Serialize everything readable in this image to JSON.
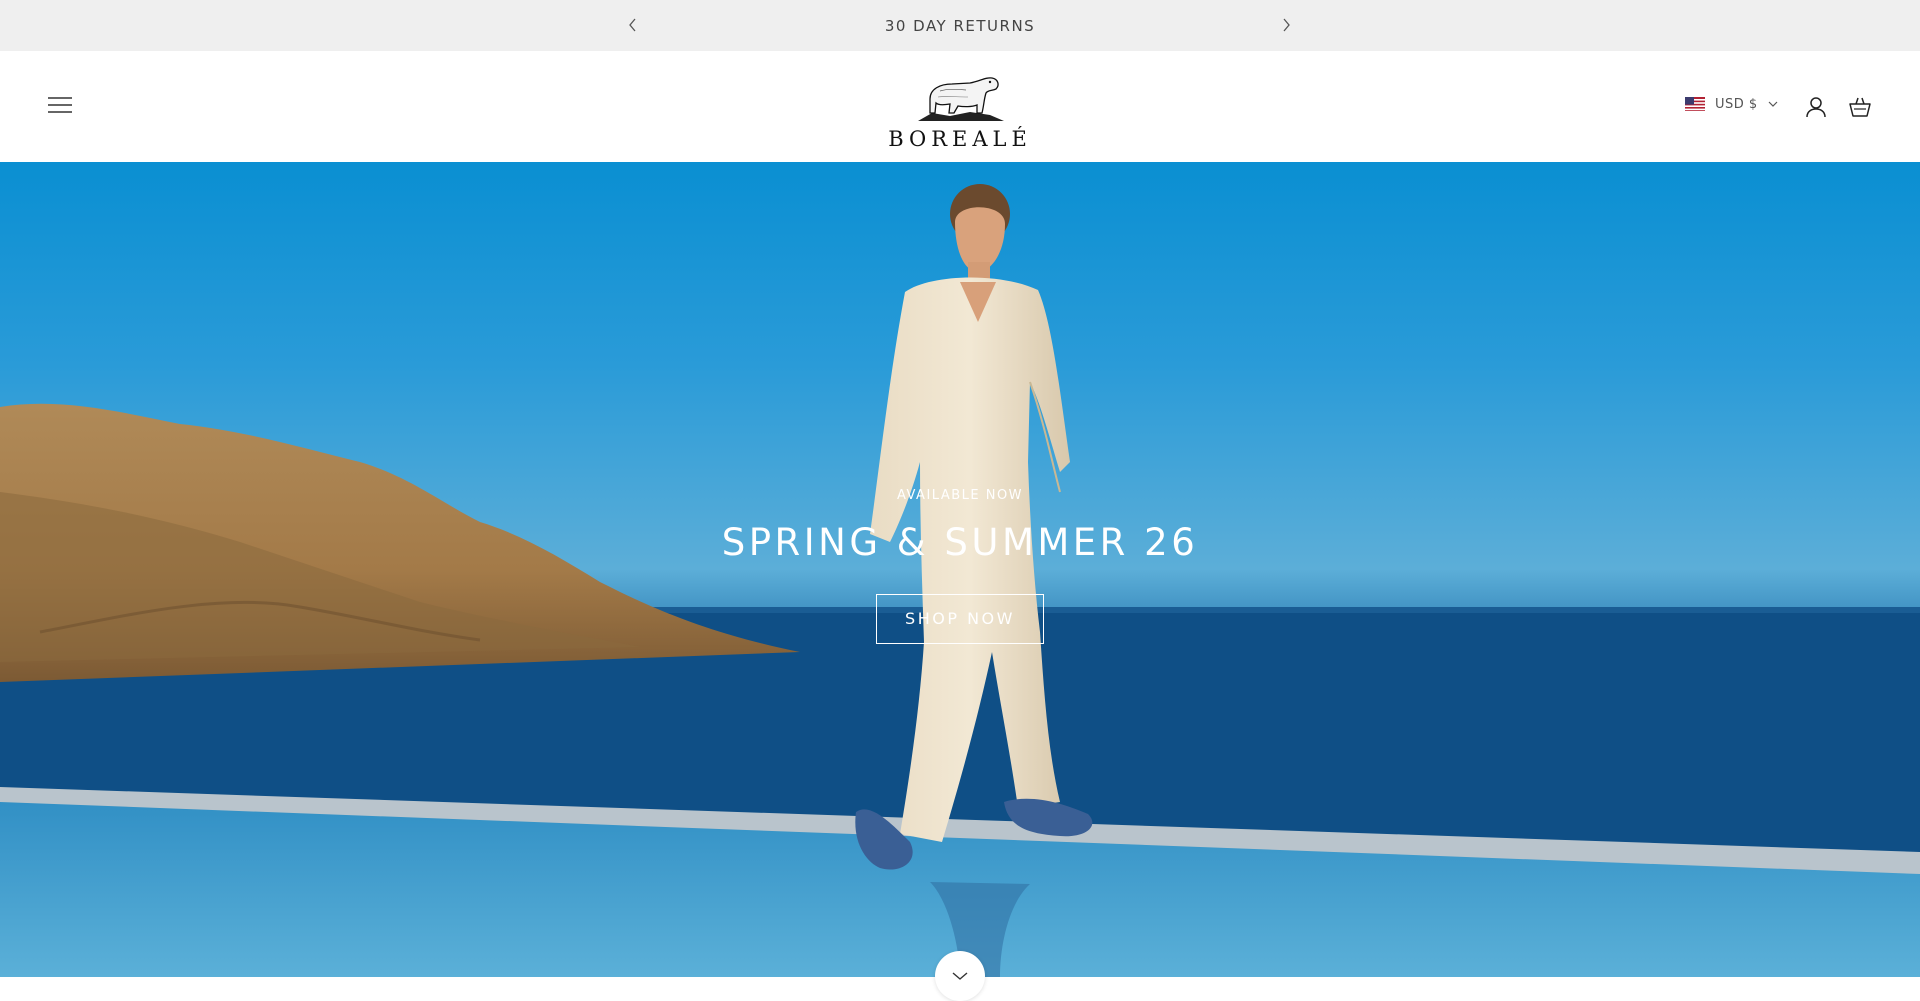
{
  "announcement": {
    "text": "30 DAY RETURNS",
    "prev_icon": "chevron-left-icon",
    "next_icon": "chevron-right-icon"
  },
  "header": {
    "brand": "BOREALÉ",
    "logo_icon": "polar-bear-icon",
    "currency": "USD $",
    "currency_flag": "us-flag-icon",
    "icons": [
      "hamburger-menu-icon",
      "user-account-icon",
      "shopping-basket-icon",
      "chevron-down-icon"
    ]
  },
  "hero": {
    "kicker": "AVAILABLE NOW",
    "title": "SPRING & SUMMER 26",
    "cta": "SHOP NOW",
    "scroll_icon": "chevron-down-icon"
  },
  "colors": {
    "announcement_bg": "#efefef",
    "sky": "#0a8fd2",
    "sea": "#0f4f86",
    "text_light": "#ffffff"
  }
}
